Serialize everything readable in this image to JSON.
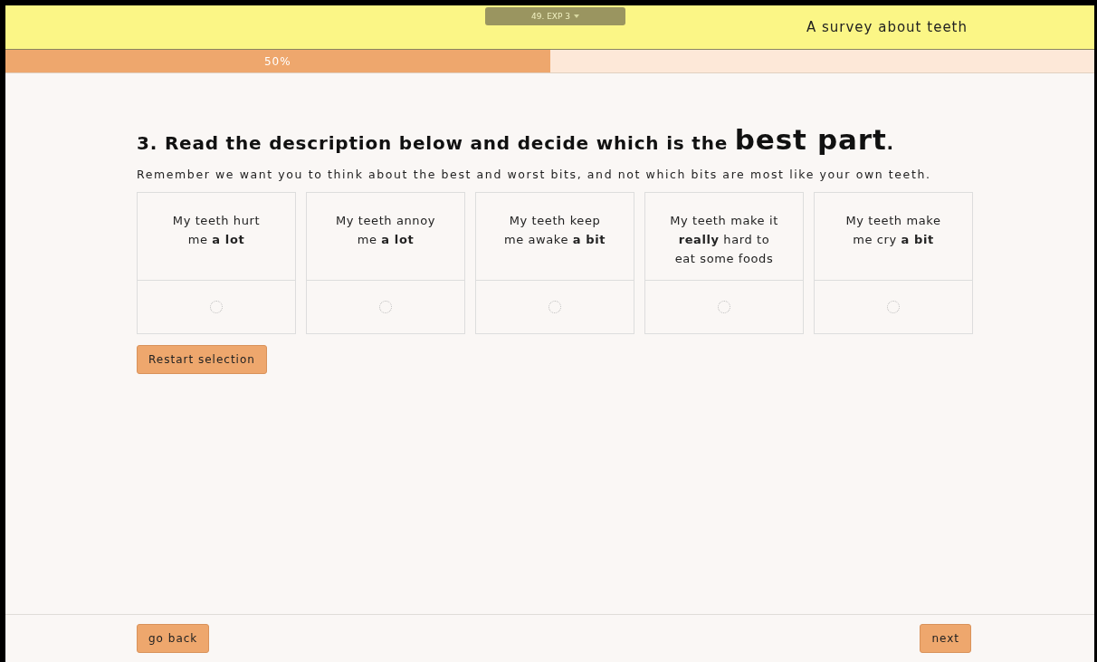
{
  "toolbar": {
    "label": "49. EXP 3"
  },
  "header": {
    "title": "A survey about teeth"
  },
  "progress": {
    "level": 0.5,
    "label": "50%"
  },
  "question": {
    "text": "3. Read the description below and decide which is the ",
    "emphasis": "best part",
    "end": "."
  },
  "instruction": "Remember we want you to think about the best and worst bits, and not which bits are most like your own teeth.",
  "options": [
    {
      "label": "My teeth hurt me **a lot**",
      "selected": false
    },
    {
      "label": "My teeth annoy me **a lot**",
      "selected": false
    },
    {
      "label": "My teeth keep me awake **a bit**",
      "selected": false
    },
    {
      "label": "My teeth make it **really** hard to eat some foods",
      "selected": false
    },
    {
      "label": "My teeth make me cry **a bit**",
      "selected": false
    }
  ],
  "restart_button": "Restart selection",
  "footer": {
    "back": "go back",
    "next": "next"
  }
}
